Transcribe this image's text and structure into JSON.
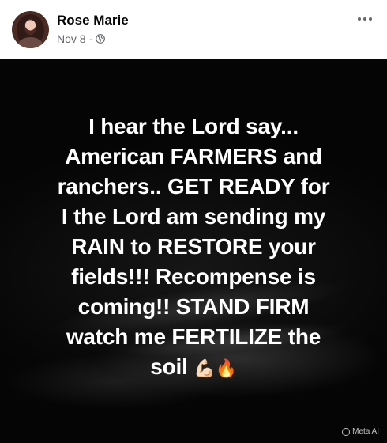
{
  "post": {
    "author": "Rose Marie",
    "date": "Nov 8",
    "separator": "·",
    "privacy_icon": "globe-icon",
    "more_icon": "more-options-icon"
  },
  "image": {
    "lines": [
      "I hear the Lord say...",
      "American FARMERS and",
      "ranchers.. GET READY for",
      "I the Lord am sending my",
      "RAIN to RESTORE your",
      "fields!!! Recompense is",
      "coming!! STAND FIRM",
      "watch me FERTILIZE the",
      "soil"
    ],
    "emojis": [
      "💪🏻",
      "🔥"
    ],
    "watermark": "Meta AI"
  }
}
